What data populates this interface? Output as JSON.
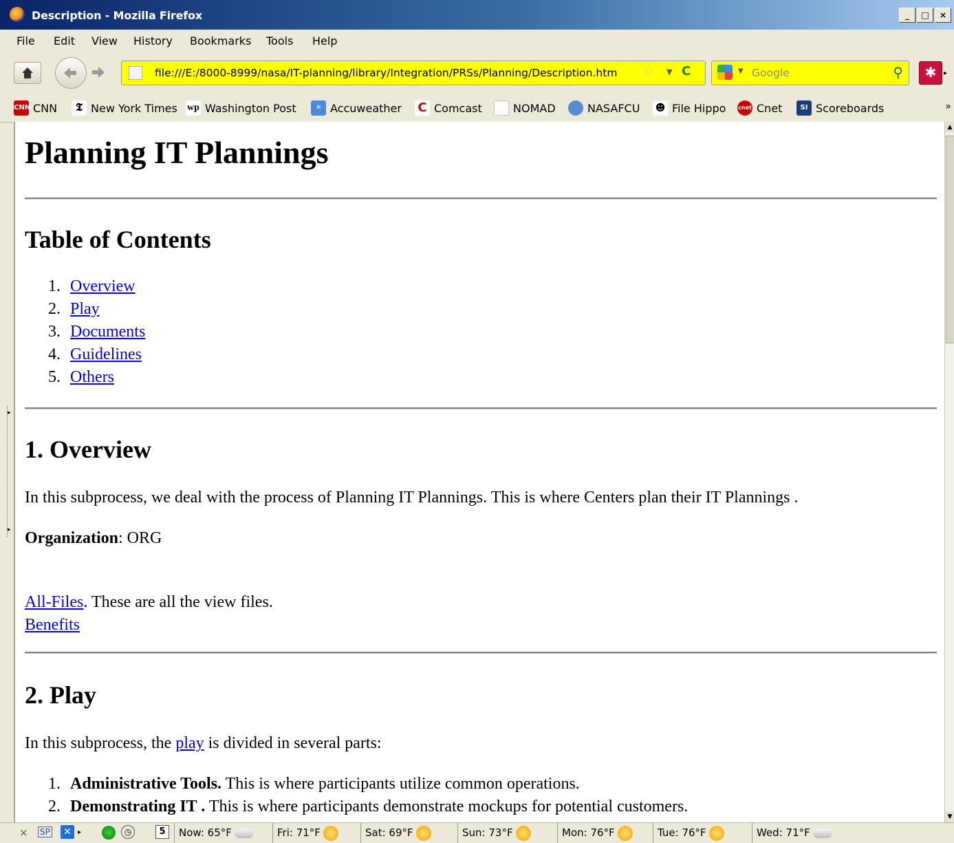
{
  "window": {
    "title": "Description - Mozilla Firefox"
  },
  "menu": {
    "items": [
      "File",
      "Edit",
      "View",
      "History",
      "Bookmarks",
      "Tools",
      "Help"
    ]
  },
  "navigation": {
    "url": "file:///E:/8000-8999/nasa/IT-planning/library/Integration/PRSs/Planning/Description.htm",
    "search_placeholder": "Google",
    "url_bar_color": "#ffff00"
  },
  "bookmarks": [
    "CNN",
    "New York Times",
    "Washington Post",
    "Accuweather",
    "Comcast",
    "NOMAD",
    "NASAFCU",
    "File Hippo",
    "Cnet",
    "Scoreboards"
  ],
  "page": {
    "title": "Planning IT Plannings",
    "toc_heading": "Table of Contents",
    "toc": [
      {
        "num": "1.",
        "label": "Overview"
      },
      {
        "num": "2.",
        "label": "Play"
      },
      {
        "num": "3.",
        "label": "Documents"
      },
      {
        "num": "4.",
        "label": "Guidelines"
      },
      {
        "num": "5.",
        "label": "Others"
      }
    ],
    "overview": {
      "heading": "1. Overview",
      "text": "In this subprocess, we deal with the process of Planning IT Plannings. This is where Centers plan their IT Plannings .",
      "org_label": "Organization",
      "org_value": ": ORG",
      "all_files_link": "All-Files",
      "all_files_text": ". These are all the view files.",
      "benefits_link": "Benefits"
    },
    "play": {
      "heading": "2. Play",
      "text_before": "In this subprocess, the ",
      "link": "play",
      "text_after": " is divided in several parts:",
      "items": [
        {
          "num": "1.",
          "bold": "Administrative Tools.",
          "text": " This is where participants utilize common operations."
        },
        {
          "num": "2.",
          "bold": "Demonstrating IT .",
          "text": " This is where participants demonstrate mockups for potential customers."
        }
      ]
    }
  },
  "statusbar": {
    "close": "×",
    "sp": "SP",
    "weather": [
      {
        "label": "Now: 65°F",
        "icon": "cloud"
      },
      {
        "label": "Fri: 71°F",
        "icon": "sun-cloud"
      },
      {
        "label": "Sat: 69°F",
        "icon": "sun"
      },
      {
        "label": "Sun: 73°F",
        "icon": "sun"
      },
      {
        "label": "Mon: 76°F",
        "icon": "sun"
      },
      {
        "label": "Tue: 76°F",
        "icon": "sun"
      },
      {
        "label": "Wed: 71°F",
        "icon": "cloud"
      }
    ]
  }
}
